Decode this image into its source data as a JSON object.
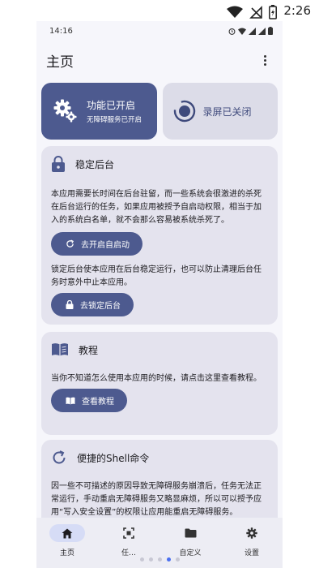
{
  "system_status": {
    "time": "2:26",
    "icons": [
      "wifi-icon",
      "signal-off-icon",
      "battery-charging-icon"
    ]
  },
  "inner_status": {
    "time": "14:16"
  },
  "app_bar": {
    "title": "主页"
  },
  "status_cards": {
    "accessibility": {
      "title": "功能已开启",
      "subtitle": "无障碍服务已开启"
    },
    "recording": {
      "title": "录屏已关闭"
    }
  },
  "cards": {
    "stable": {
      "title": "稳定后台",
      "para1": "本应用需要长时间在后台驻留，而一些系统会很激进的杀死在后台运行的任务，如果应用被授予自启动权限，相当于加入的系统白名单，就不会那么容易被系统杀死了。",
      "btn1": "去开启自启动",
      "para2": "锁定后台使本应用在后台稳定运行，也可以防止清理后台任务时意外中止本应用。",
      "btn2": "去锁定后台"
    },
    "tutorial": {
      "title": "教程",
      "para": "当你不知道怎么使用本应用的时候，请点击这里查看教程。",
      "btn": "查看教程"
    },
    "shell": {
      "title": "便捷的Shell命令",
      "para": "因一些不可描述的原因导致无障碍服务崩溃后，任务无法正常运行，手动重启无障碍服务又略显麻烦，所以可以授予应用“写入安全设置”的权限让应用能重启无障碍服务。"
    }
  },
  "bottom_nav": [
    {
      "label": "主页",
      "active": true
    },
    {
      "label": "任…",
      "active": false
    },
    {
      "label": "自定义",
      "active": false
    },
    {
      "label": "设置",
      "active": false
    }
  ],
  "colors": {
    "primary": "#4d5a8f",
    "card_bg": "#e4e3ee",
    "screen_bg": "#f6f6fb",
    "nav_bg": "#ededf4"
  }
}
